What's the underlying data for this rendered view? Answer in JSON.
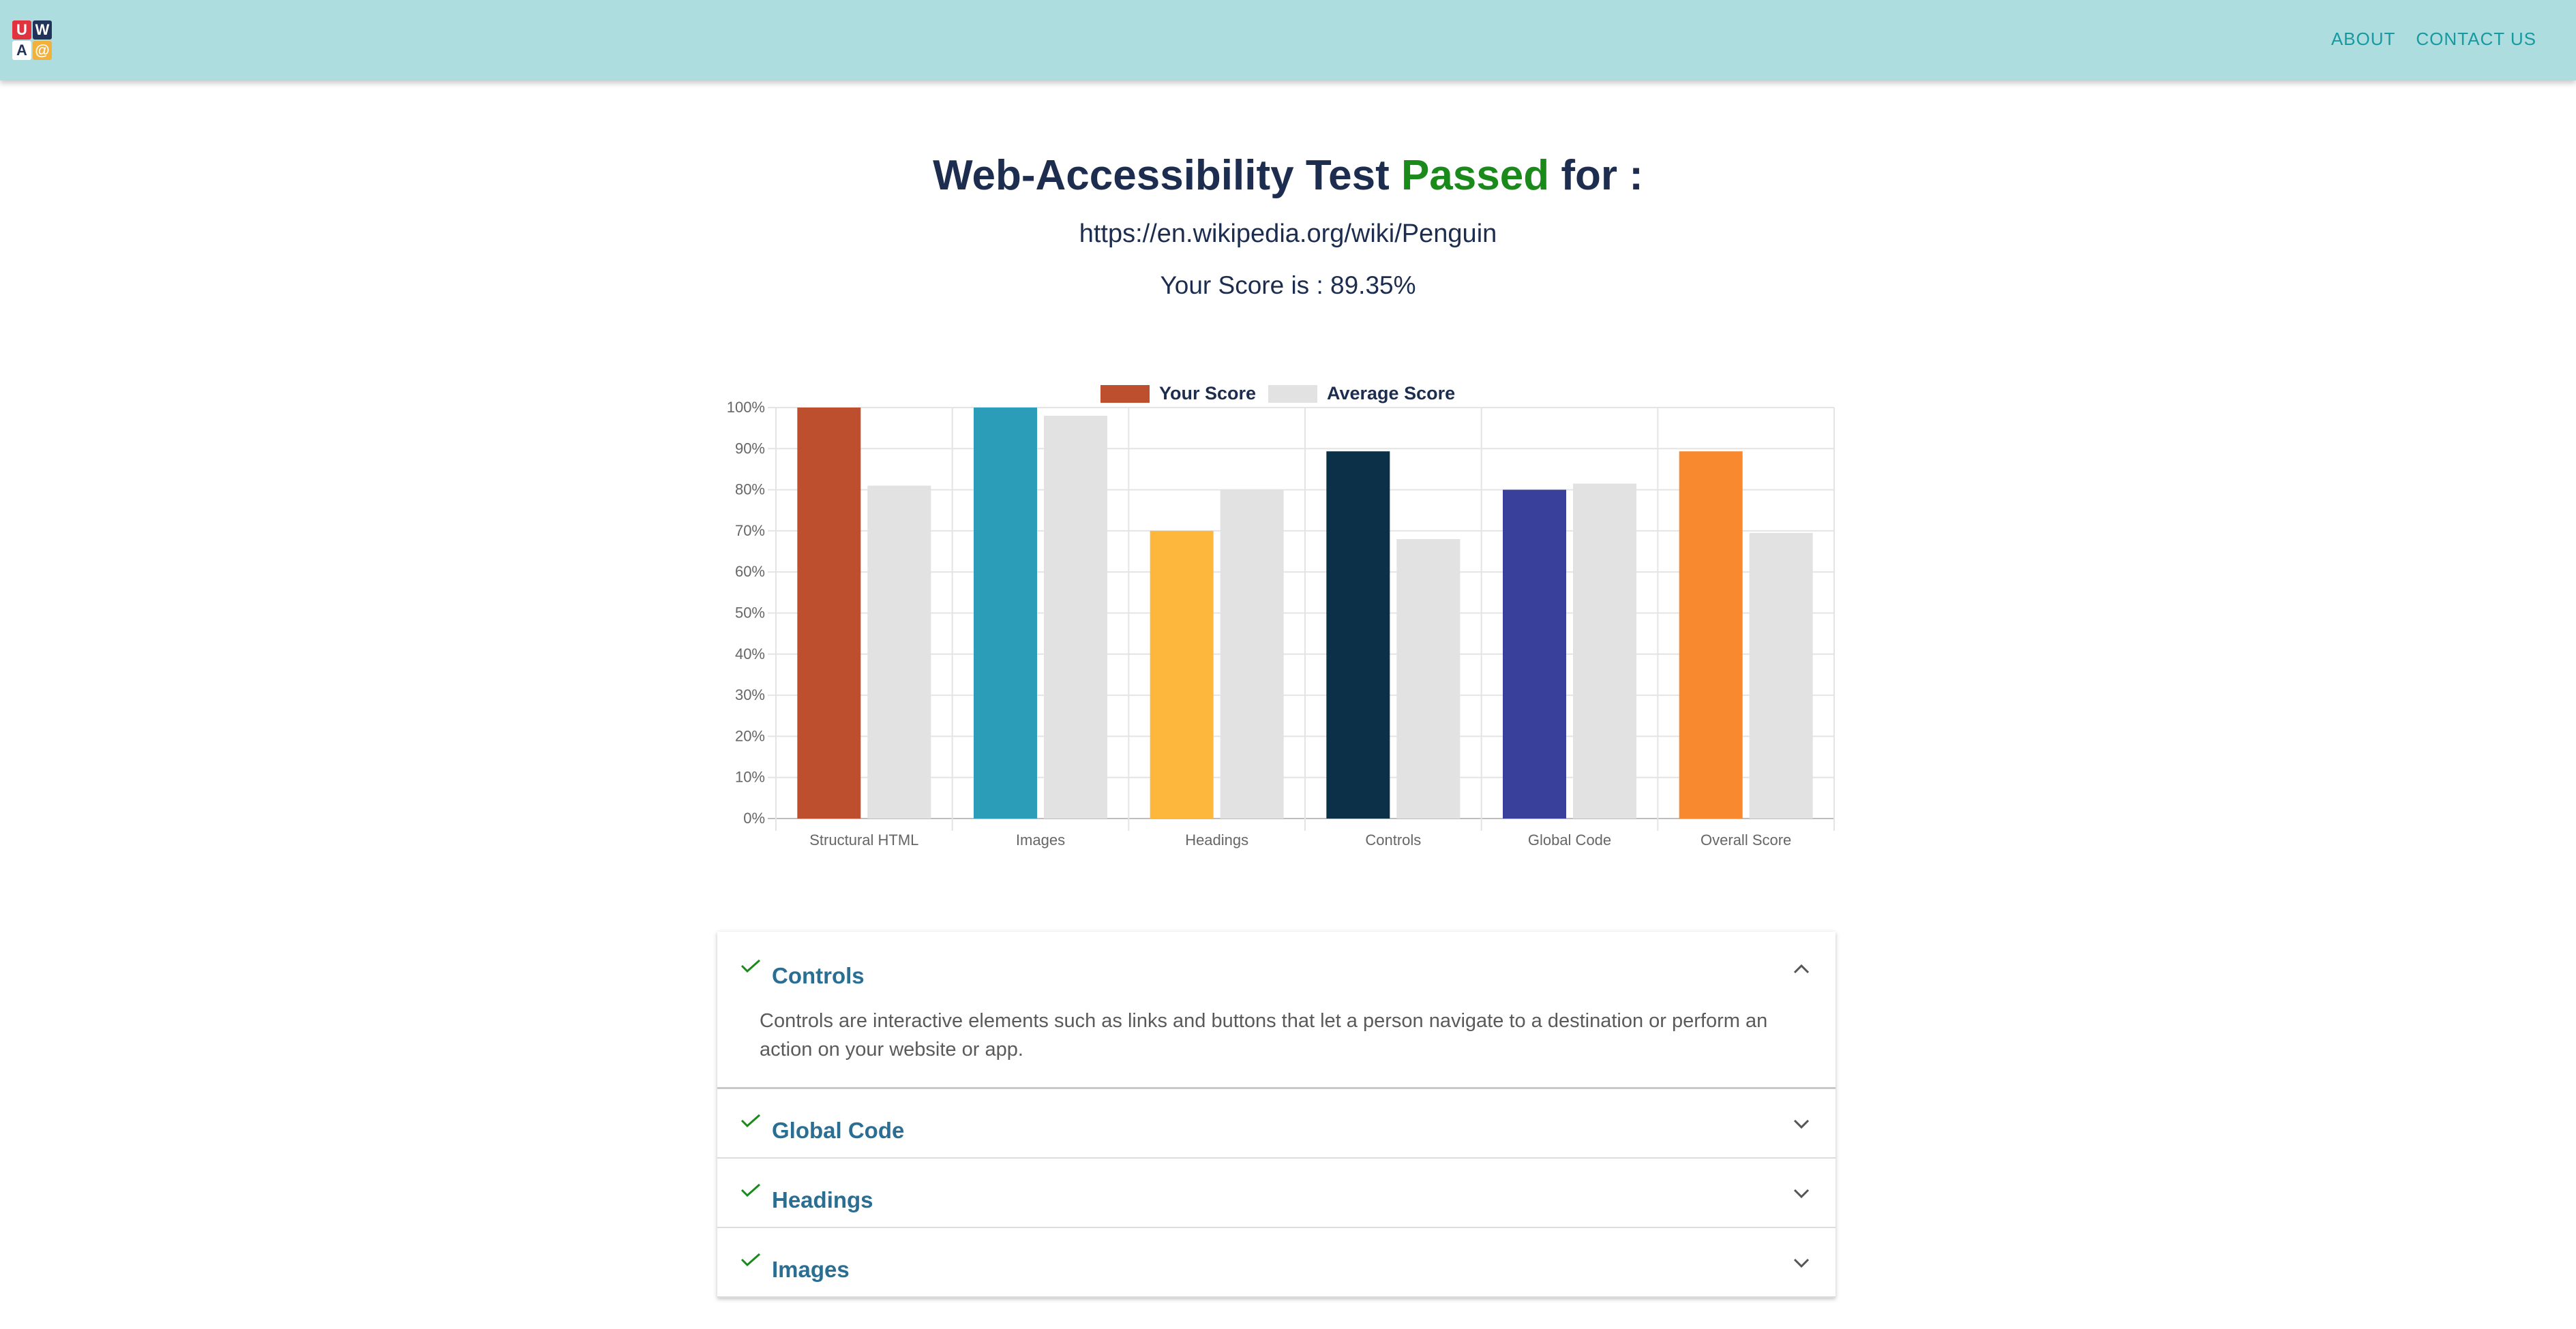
{
  "header": {
    "logo_letters": [
      "U",
      "W",
      "A",
      "@"
    ],
    "nav": [
      {
        "label": "ABOUT"
      },
      {
        "label": "CONTACT US"
      }
    ]
  },
  "result": {
    "title_prefix": "Web-Accessibility Test ",
    "title_status": "Passed",
    "title_suffix": " for :",
    "url": "https://en.wikipedia.org/wiki/Penguin",
    "score_text": "Your Score is : 89.35%"
  },
  "chart_data": {
    "type": "bar",
    "categories": [
      "Structural HTML",
      "Images",
      "Headings",
      "Controls",
      "Global Code",
      "Overall Score"
    ],
    "series": [
      {
        "name": "Your Score",
        "values": [
          100,
          100,
          70,
          89.35,
          80,
          89.35
        ],
        "colors": [
          "#bd4f2e",
          "#2c9db9",
          "#fdb73c",
          "#0b3048",
          "#38409c",
          "#f8892e"
        ]
      },
      {
        "name": "Average Score",
        "values": [
          81,
          98,
          80,
          68,
          81.5,
          69.5
        ],
        "color": "#e2e2e2"
      }
    ],
    "legend_swatch_color": "#bd4f2e",
    "ylim": [
      0,
      100
    ],
    "yticks": [
      "0%",
      "10%",
      "20%",
      "30%",
      "40%",
      "50%",
      "60%",
      "70%",
      "80%",
      "90%",
      "100%"
    ],
    "grid": true,
    "legend_position": "top"
  },
  "accordion": [
    {
      "title": "Controls",
      "open": true,
      "body": "Controls are interactive elements such as links and buttons that let a person navigate to a destination or perform an action on your website or app."
    },
    {
      "title": "Global Code",
      "open": false
    },
    {
      "title": "Headings",
      "open": false
    },
    {
      "title": "Images",
      "open": false
    }
  ],
  "colors": {
    "header_bg": "#aedde0",
    "nav_link": "#159aa0",
    "title": "#1d2d4f",
    "passed": "#1a8a1a",
    "accordion_title": "#2a6f93",
    "check": "#1a8a1a"
  }
}
